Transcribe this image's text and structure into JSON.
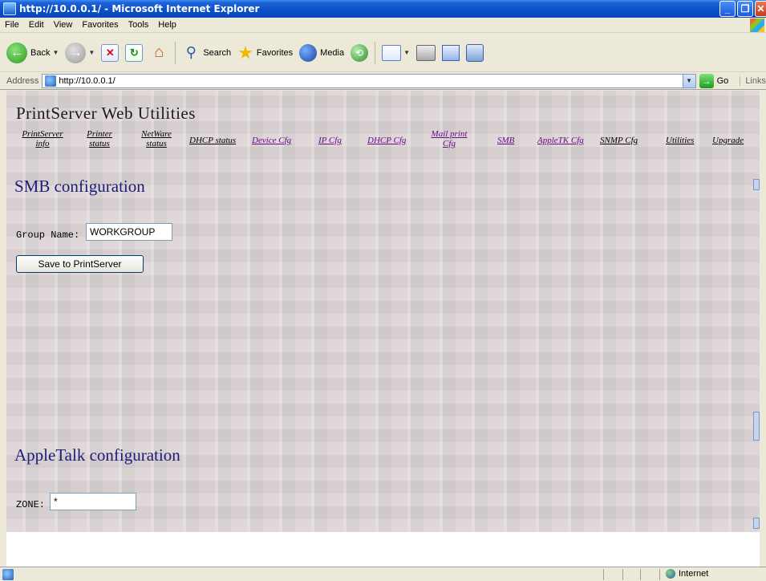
{
  "window": {
    "title": "http://10.0.0.1/ - Microsoft Internet Explorer"
  },
  "menu": [
    "File",
    "Edit",
    "View",
    "Favorites",
    "Tools",
    "Help"
  ],
  "toolbar": {
    "back_label": "Back",
    "search_label": "Search",
    "favorites_label": "Favorites",
    "media_label": "Media"
  },
  "address": {
    "label": "Address",
    "url": "http://10.0.0.1/",
    "go_label": "Go",
    "links_label": "Links"
  },
  "page": {
    "title": "PrintServer Web Utilities",
    "nav": [
      {
        "line1": "PrintServer",
        "line2": "info",
        "visited": false
      },
      {
        "line1": "Printer",
        "line2": "status",
        "visited": false
      },
      {
        "line1": "NetWare",
        "line2": "status",
        "visited": false
      },
      {
        "line1": "DHCP status",
        "line2": "",
        "visited": false
      },
      {
        "line1": "Device Cfg",
        "line2": "",
        "visited": true
      },
      {
        "line1": "IP Cfg",
        "line2": "",
        "visited": true
      },
      {
        "line1": "DHCP Cfg",
        "line2": "",
        "visited": true
      },
      {
        "line1": "Mail print",
        "line2": "Cfg",
        "visited": true
      },
      {
        "line1": "SMB",
        "line2": "",
        "visited": true
      },
      {
        "line1": "AppleTK Cfg",
        "line2": "",
        "visited": true
      },
      {
        "line1": "SNMP Cfg",
        "line2": "",
        "visited": false
      },
      {
        "line1": "Utilities",
        "line2": "",
        "visited": false
      },
      {
        "line1": "Upgrade",
        "line2": "",
        "visited": false
      }
    ],
    "smb": {
      "heading": "SMB configuration",
      "group_name_label": "Group Name:",
      "group_name_value": "WORKGROUP",
      "save_label": "Save to PrintServer"
    },
    "appletalk": {
      "heading": "AppleTalk configuration",
      "zone_label": "ZONE:",
      "zone_value": "*"
    }
  },
  "status": {
    "zone": "Internet"
  }
}
